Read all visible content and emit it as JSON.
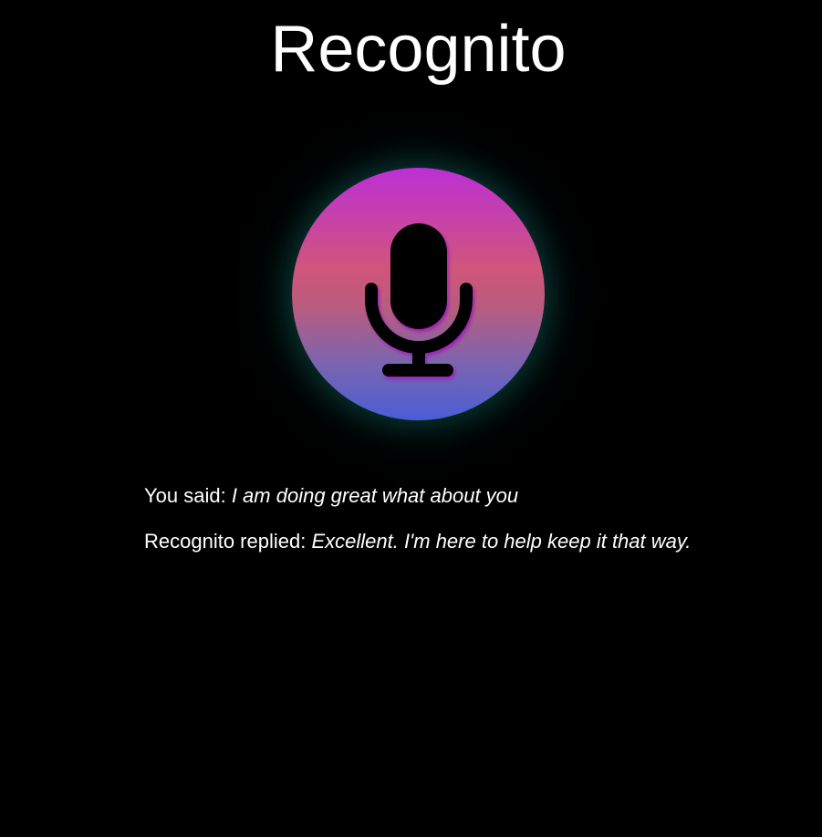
{
  "app": {
    "title": "Recognito"
  },
  "mic": {
    "icon": "microphone-icon",
    "gradient_colors": [
      "#bc2fd6",
      "#d0557a",
      "#7a64b0",
      "#4a5ed6"
    ],
    "glow_color": "#14786e"
  },
  "conversation": {
    "user_label": "You said: ",
    "user_text": "I am doing great what about you",
    "reply_label": "Recognito replied: ",
    "reply_text": "Excellent. I'm here to help keep it that way."
  }
}
